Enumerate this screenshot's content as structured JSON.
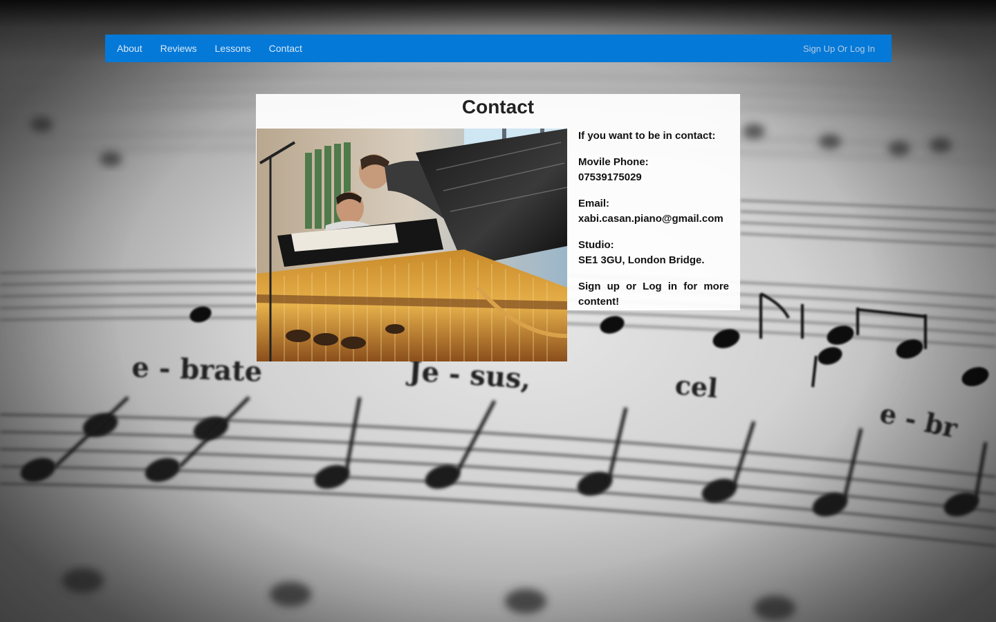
{
  "nav": {
    "links": [
      {
        "label": "About"
      },
      {
        "label": "Reviews"
      },
      {
        "label": "Lessons"
      },
      {
        "label": "Contact"
      }
    ],
    "auth_label": "Sign Up Or Log In",
    "bar_color": "#0479d8"
  },
  "main": {
    "title": "Contact",
    "photo_subject": "pianist-at-grand-piano-photo",
    "intro": "If you want to be in contact:",
    "phone": {
      "label": "Movile Phone:",
      "value": "07539175029"
    },
    "email": {
      "label": "Email:",
      "value": "xabi.casan.piano@gmail.com"
    },
    "studio": {
      "label": "Studio:",
      "value": "SE1 3GU, London Bridge."
    },
    "cta": "Sign up or Log in for more content!"
  },
  "background": {
    "lyrics": [
      "e - brate",
      "Je - sus,",
      "cel",
      "e - br"
    ]
  }
}
